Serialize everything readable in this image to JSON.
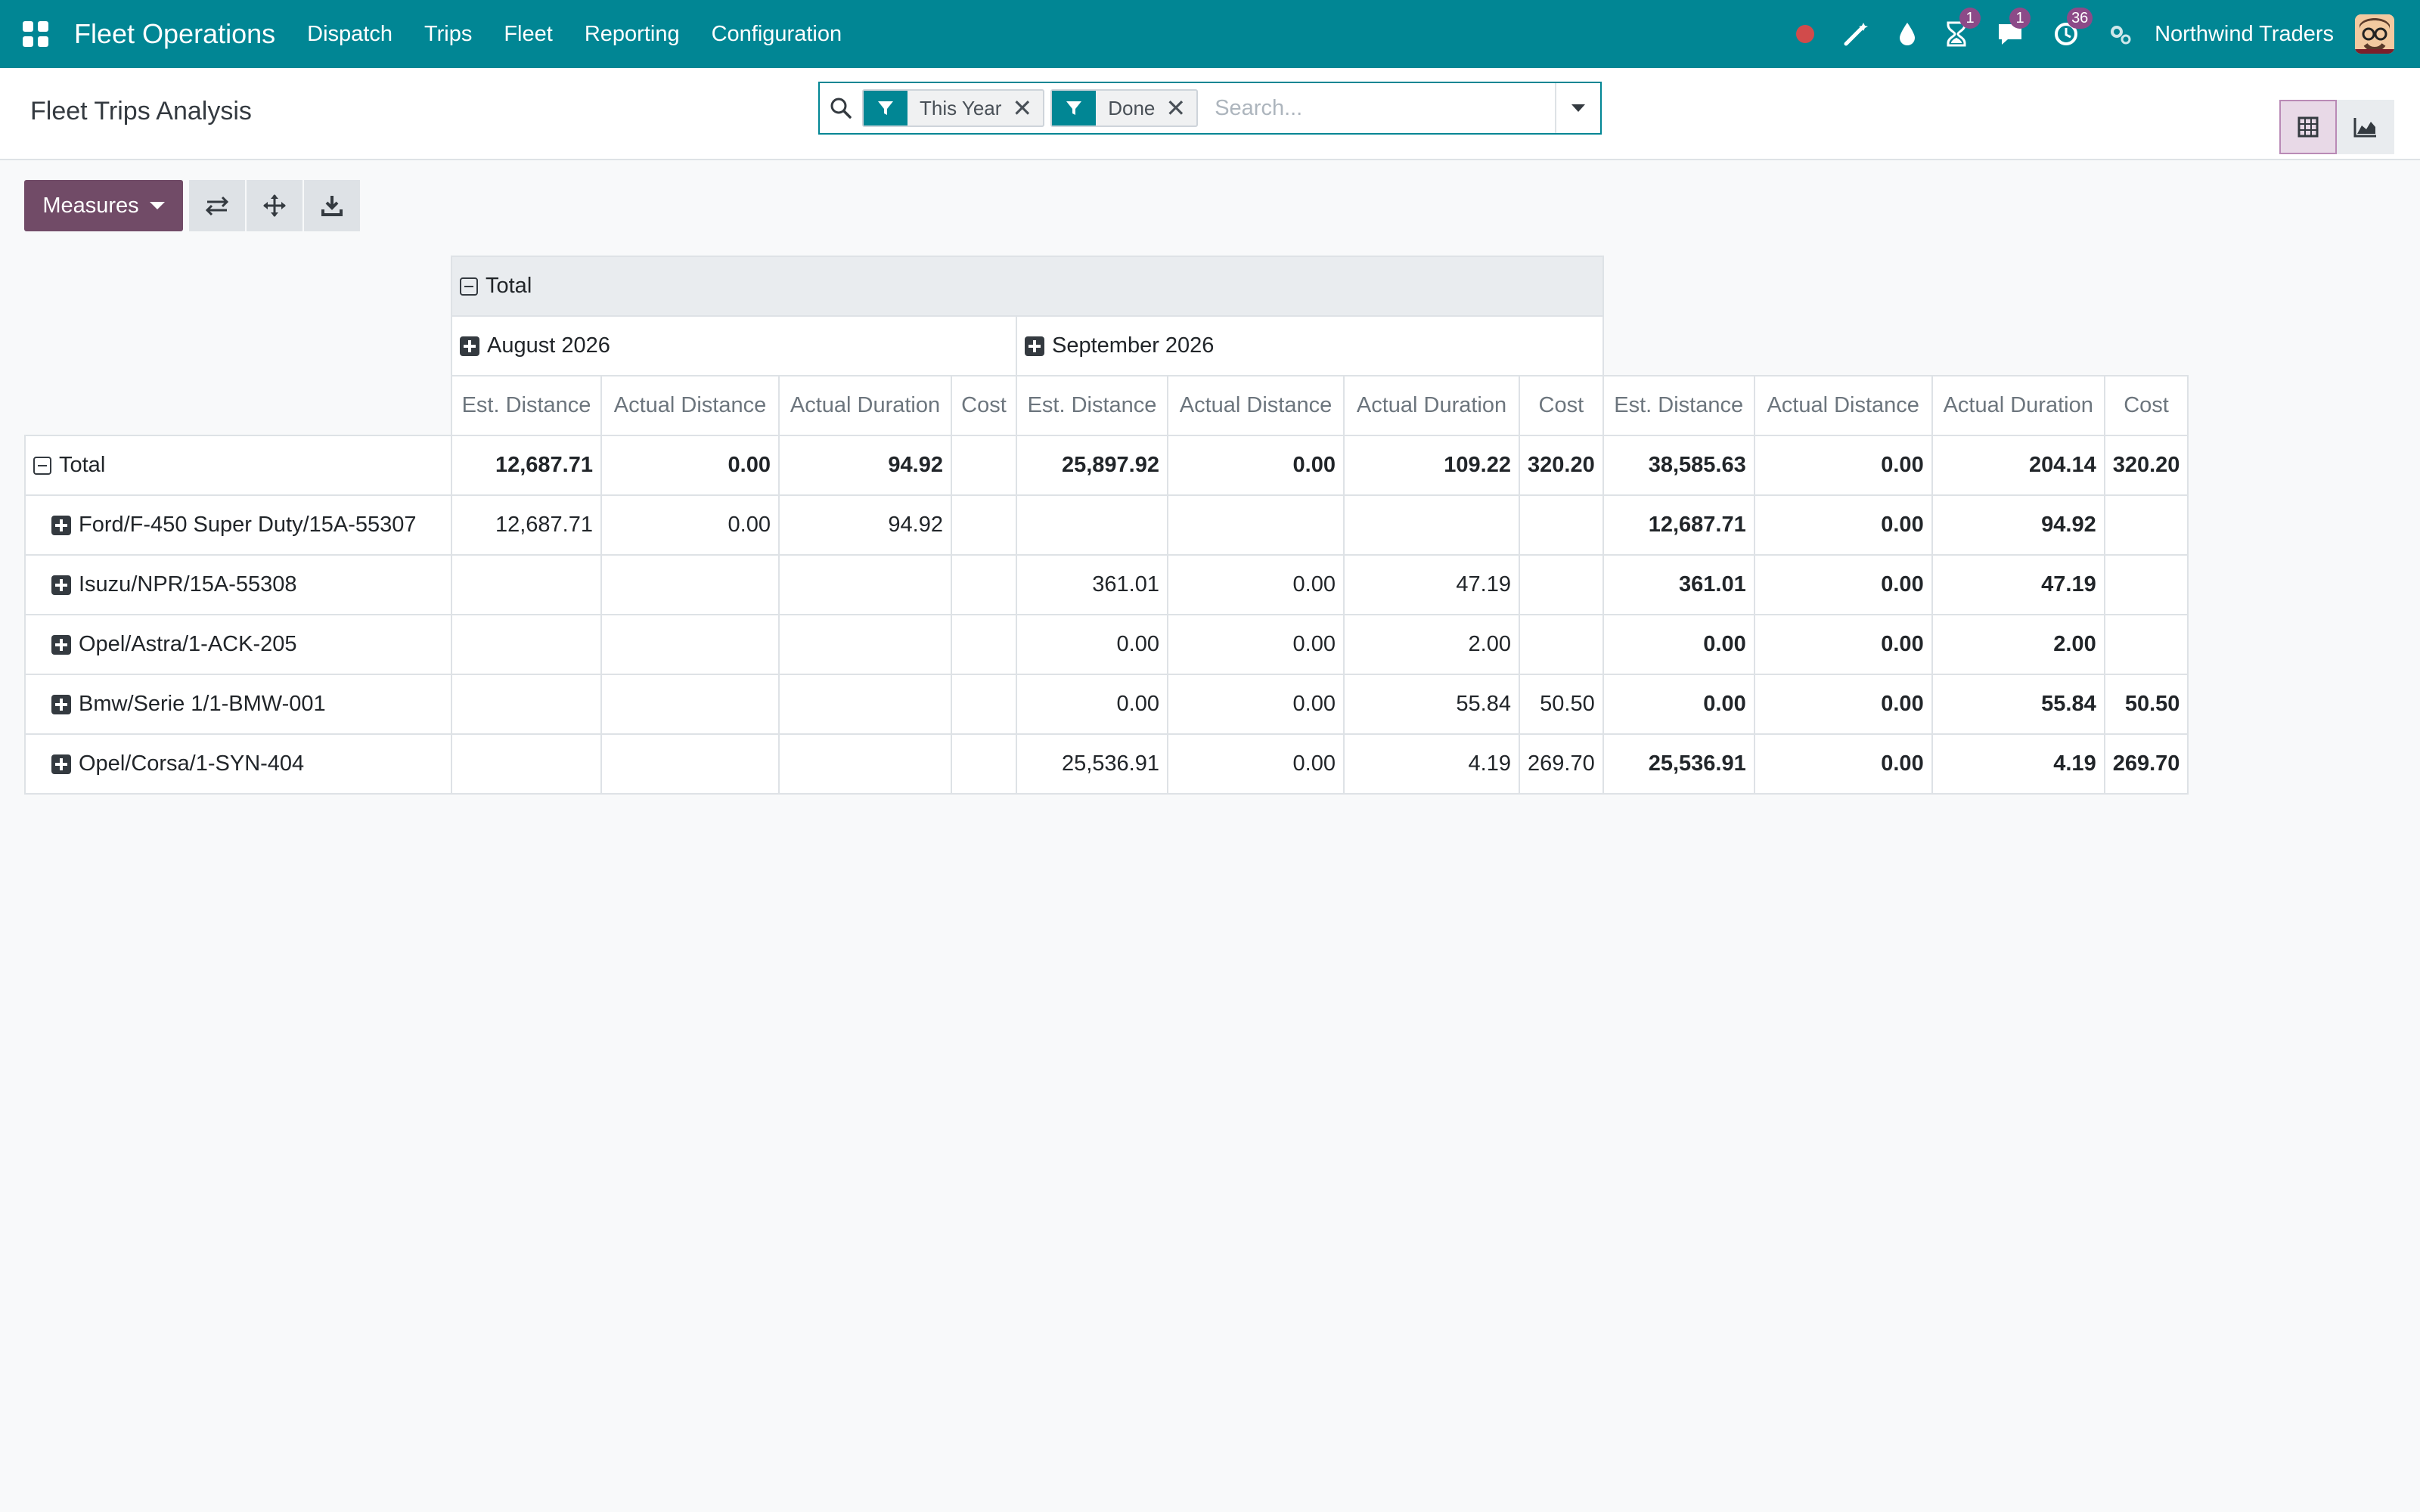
{
  "navbar": {
    "app_name": "Fleet Operations",
    "menu": [
      "Dispatch",
      "Trips",
      "Fleet",
      "Reporting",
      "Configuration"
    ],
    "company": "Northwind Traders",
    "badges": {
      "activity": "1",
      "messages": "1",
      "clock": "36"
    },
    "icons": [
      "apps-grid-icon",
      "record-icon",
      "magic-wand-icon",
      "drop-icon",
      "hourglass-icon",
      "chat-icon",
      "clock-icon",
      "settings-icon"
    ]
  },
  "control_panel": {
    "title": "Fleet Trips Analysis",
    "facets": [
      "This Year",
      "Done"
    ],
    "search_placeholder": "Search..."
  },
  "toolbar": {
    "measures_label": "Measures"
  },
  "colors": {
    "navbar": "#018694",
    "primary": "#714b67",
    "facet_tag": "#018694",
    "record_dot": "#d14b4b"
  },
  "pivot": {
    "col_total_label": "Total",
    "months": [
      "August 2026",
      "September 2026"
    ],
    "measures": [
      "Est. Distance",
      "Actual Distance",
      "Actual Duration",
      "Cost",
      "Est. Distance",
      "Actual Distance",
      "Actual Duration",
      "Cost",
      "Est. Distance",
      "Actual Distance",
      "Actual Duration",
      "Cost"
    ],
    "row_total_label": "Total",
    "total_row": [
      "12,687.71",
      "0.00",
      "94.92",
      "",
      "25,897.92",
      "0.00",
      "109.22",
      "320.20",
      "38,585.63",
      "0.00",
      "204.14",
      "320.20"
    ],
    "rows": [
      {
        "label": "Ford/F-450 Super Duty/15A-55307",
        "values": [
          "12,687.71",
          "0.00",
          "94.92",
          "",
          "",
          "",
          "",
          "",
          "12,687.71",
          "0.00",
          "94.92",
          ""
        ]
      },
      {
        "label": "Isuzu/NPR/15A-55308",
        "values": [
          "",
          "",
          "",
          "",
          "361.01",
          "0.00",
          "47.19",
          "",
          "361.01",
          "0.00",
          "47.19",
          ""
        ]
      },
      {
        "label": "Opel/Astra/1-ACK-205",
        "values": [
          "",
          "",
          "",
          "",
          "0.00",
          "0.00",
          "2.00",
          "",
          "0.00",
          "0.00",
          "2.00",
          ""
        ]
      },
      {
        "label": "Bmw/Serie 1/1-BMW-001",
        "values": [
          "",
          "",
          "",
          "",
          "0.00",
          "0.00",
          "55.84",
          "50.50",
          "0.00",
          "0.00",
          "55.84",
          "50.50"
        ]
      },
      {
        "label": "Opel/Corsa/1-SYN-404",
        "values": [
          "",
          "",
          "",
          "",
          "25,536.91",
          "0.00",
          "4.19",
          "269.70",
          "25,536.91",
          "0.00",
          "4.19",
          "269.70"
        ]
      }
    ]
  }
}
